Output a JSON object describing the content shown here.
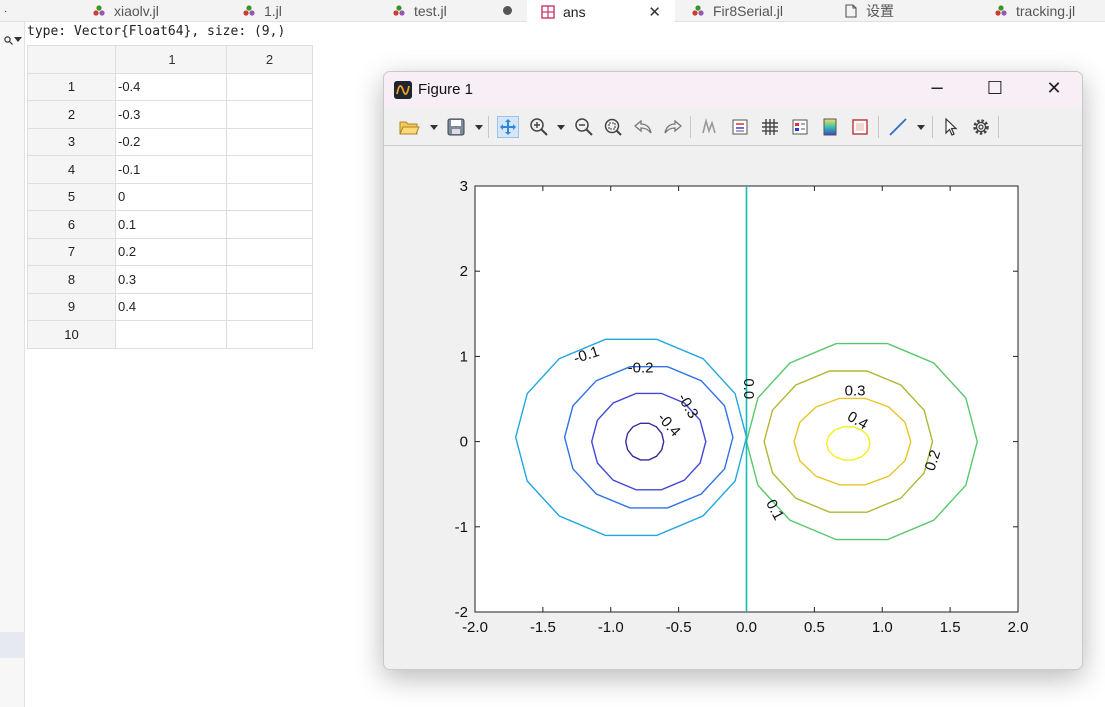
{
  "tabs": [
    {
      "label": "xiaolv.jl"
    },
    {
      "label": "1.jl"
    },
    {
      "label": "test.jl"
    },
    {
      "label": "ans"
    },
    {
      "label": "Fir8Serial.jl"
    },
    {
      "label": "设置"
    },
    {
      "label": "tracking.jl"
    }
  ],
  "variable": {
    "type_line": "type: Vector{Float64}, size: (9,)",
    "col_headers": [
      "1",
      "2"
    ],
    "rows": [
      {
        "idx": "1",
        "v1": "-0.4",
        "v2": ""
      },
      {
        "idx": "2",
        "v1": "-0.3",
        "v2": ""
      },
      {
        "idx": "3",
        "v1": "-0.2",
        "v2": ""
      },
      {
        "idx": "4",
        "v1": "-0.1",
        "v2": ""
      },
      {
        "idx": "5",
        "v1": "0",
        "v2": ""
      },
      {
        "idx": "6",
        "v1": "0.1",
        "v2": ""
      },
      {
        "idx": "7",
        "v1": "0.2",
        "v2": ""
      },
      {
        "idx": "8",
        "v1": "0.3",
        "v2": ""
      },
      {
        "idx": "9",
        "v1": "0.4",
        "v2": ""
      },
      {
        "idx": "10",
        "v1": "",
        "v2": ""
      }
    ]
  },
  "figure": {
    "title": "Figure 1",
    "toolbar": [
      "open-icon",
      "save-icon",
      "pan-icon",
      "zoom-in-icon",
      "zoom-out-icon",
      "zoom-reset-icon",
      "undo-icon",
      "redo-icon",
      "datacursor-icon",
      "legend-icon",
      "grid-icon",
      "colorbar-icon",
      "colormap-icon",
      "box-icon",
      "line-icon",
      "pointer-icon",
      "settings-icon"
    ]
  },
  "chart_data": {
    "type": "contour",
    "xlim": [
      -2.0,
      2.0
    ],
    "ylim": [
      -2,
      3
    ],
    "x_ticks": [
      "-2.0",
      "-1.5",
      "-1.0",
      "-0.5",
      "0.0",
      "0.5",
      "1.0",
      "1.5",
      "2.0"
    ],
    "y_ticks": [
      "3",
      "2",
      "1",
      "0",
      "-1",
      "-2"
    ],
    "levels": [
      -0.4,
      -0.3,
      -0.2,
      -0.1,
      0.0,
      0.1,
      0.2,
      0.3,
      0.4
    ],
    "level_labels": [
      "-0.1",
      "-0.2",
      "-0.3",
      "-0.4",
      "0.0",
      "0.3",
      "0.4",
      "0.2",
      "0.1"
    ],
    "colors": {
      "-0.4": "#3a2a9a",
      "-0.3": "#4048d8",
      "-0.2": "#2f72e8",
      "-0.1": "#22a6e0",
      "0.0": "#14bcb8",
      "0.1": "#58c86a",
      "0.2": "#b0b830",
      "0.3": "#e8c428",
      "0.4": "#f4f020"
    },
    "centers": {
      "negative": [
        -0.75,
        0.0
      ],
      "positive": [
        0.75,
        0.0
      ]
    },
    "grid": false
  }
}
